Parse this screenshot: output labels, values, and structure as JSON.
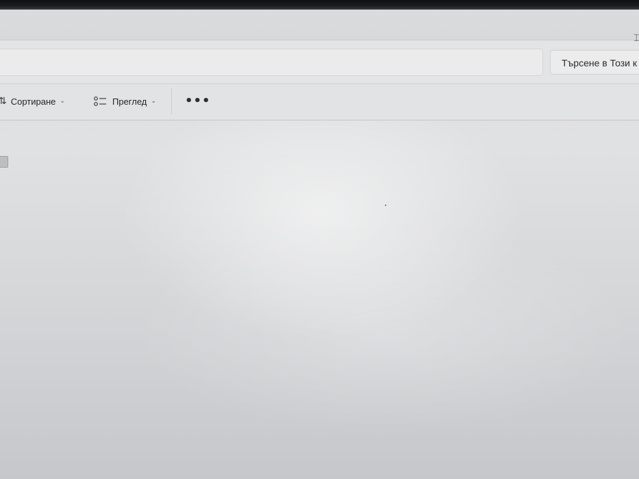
{
  "search": {
    "placeholder": "Търсене в Този к"
  },
  "toolbar": {
    "sort_label": "Сортиране",
    "view_label": "Преглед",
    "more_label": "•••"
  },
  "icons": {
    "sort": "sort-icon",
    "view": "view-icon",
    "more": "more-icon",
    "chevron": "chevron-down-icon"
  },
  "colors": {
    "toolbar_bg": "#e2e3e4",
    "content_bg": "#dcdddf"
  }
}
